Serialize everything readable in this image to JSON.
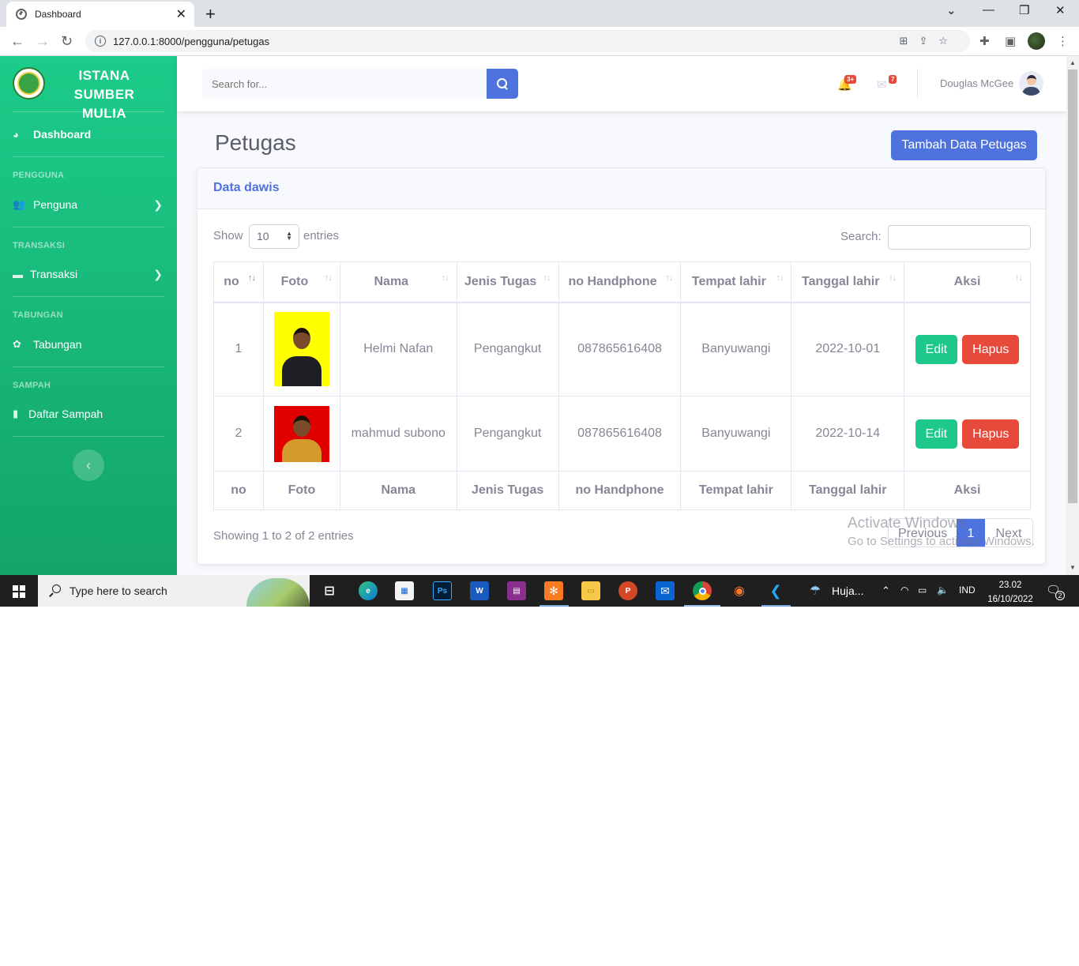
{
  "browser": {
    "tab_title": "Dashboard",
    "url": "127.0.0.1:8000/pengguna/petugas"
  },
  "sidebar": {
    "brand_line1": "ISTANA",
    "brand_line2": "SUMBER MULIA",
    "dashboard_label": "Dashboard",
    "sections": [
      {
        "heading": "PENGGUNA",
        "item": "Penguna"
      },
      {
        "heading": "TRANSAKSI",
        "item": "Transaksi"
      },
      {
        "heading": "TABUNGAN",
        "item": "Tabungan"
      },
      {
        "heading": "SAMPAH",
        "item": "Daftar Sampah"
      }
    ]
  },
  "topbar": {
    "search_placeholder": "Search for...",
    "alerts_badge": "3+",
    "messages_badge": "7",
    "user_name": "Douglas McGee"
  },
  "page": {
    "title": "Petugas",
    "add_button": "Tambah Data Petugas",
    "card_title": "Data dawis"
  },
  "datatable": {
    "show_label": "Show",
    "length_value": "10",
    "entries_label": "entries",
    "search_label": "Search:",
    "columns": [
      "no",
      "Foto",
      "Nama",
      "Jenis Tugas",
      "no Handphone",
      "Tempat lahir",
      "Tanggal lahir",
      "Aksi"
    ],
    "rows": [
      {
        "no": "1",
        "nama": "Helmi Nafan",
        "jenis_tugas": "Pengangkut",
        "no_hp": "087865616408",
        "tempat_lahir": "Banyuwangi",
        "tanggal_lahir": "2022-10-01",
        "photo_bg": "#ffff00"
      },
      {
        "no": "2",
        "nama": "mahmud subono",
        "jenis_tugas": "Pengangkut",
        "no_hp": "087865616408",
        "tempat_lahir": "Banyuwangi",
        "tanggal_lahir": "2022-10-14",
        "photo_bg": "#e00000"
      }
    ],
    "edit_label": "Edit",
    "delete_label": "Hapus",
    "info": "Showing 1 to 2 of 2 entries",
    "prev_label": "Previous",
    "current_page": "1",
    "next_label": "Next"
  },
  "watermark": {
    "line1": "Activate Windows",
    "line2": "Go to Settings to activate Windows."
  },
  "taskbar": {
    "search_placeholder": "Type here to search",
    "weather": "Huja...",
    "language": "IND",
    "time": "23.02",
    "date": "16/10/2022",
    "notifications": "2"
  },
  "colors": {
    "sidebar_top": "#1ccc8a",
    "sidebar_bottom": "#13a468",
    "primary": "#4e73df",
    "success": "#1cc88a",
    "danger": "#e74a3b"
  }
}
